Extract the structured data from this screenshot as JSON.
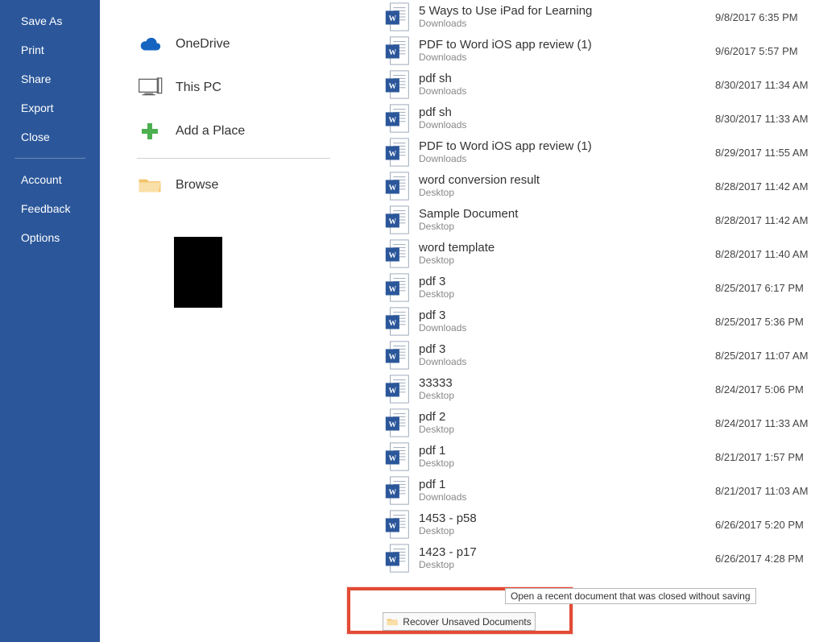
{
  "sidebar": {
    "items": [
      {
        "label": "Save As"
      },
      {
        "label": "Print"
      },
      {
        "label": "Share"
      },
      {
        "label": "Export"
      },
      {
        "label": "Close"
      }
    ],
    "items2": [
      {
        "label": "Account"
      },
      {
        "label": "Feedback"
      },
      {
        "label": "Options"
      }
    ]
  },
  "locations": [
    {
      "icon": "onedrive",
      "label": "OneDrive"
    },
    {
      "icon": "thispc",
      "label": "This PC"
    },
    {
      "icon": "plus",
      "label": "Add a Place"
    },
    {
      "icon": "folder",
      "label": "Browse"
    }
  ],
  "files": [
    {
      "name": "5 Ways to Use iPad for Learning",
      "loc": "Downloads",
      "date": "9/8/2017 6:35 PM"
    },
    {
      "name": "PDF to Word iOS app review (1)",
      "loc": "Downloads",
      "date": "9/6/2017 5:57 PM"
    },
    {
      "name": "pdf sh",
      "loc": "Downloads",
      "date": "8/30/2017 11:34 AM"
    },
    {
      "name": "pdf sh",
      "loc": "Downloads",
      "date": "8/30/2017 11:33 AM"
    },
    {
      "name": "PDF to Word iOS app review (1)",
      "loc": "Downloads",
      "date": "8/29/2017 11:55 AM"
    },
    {
      "name": "word conversion result",
      "loc": "Desktop",
      "date": "8/28/2017 11:42 AM"
    },
    {
      "name": "Sample Document",
      "loc": "Desktop",
      "date": "8/28/2017 11:42 AM"
    },
    {
      "name": "word template",
      "loc": "Desktop",
      "date": "8/28/2017 11:40 AM"
    },
    {
      "name": "pdf 3",
      "loc": "Desktop",
      "date": "8/25/2017 6:17 PM"
    },
    {
      "name": "pdf 3",
      "loc": "Downloads",
      "date": "8/25/2017 5:36 PM"
    },
    {
      "name": "pdf 3",
      "loc": "Downloads",
      "date": "8/25/2017 11:07 AM"
    },
    {
      "name": "33333",
      "loc": "Desktop",
      "date": "8/24/2017 5:06 PM"
    },
    {
      "name": "pdf 2",
      "loc": "Desktop",
      "date": "8/24/2017 11:33 AM"
    },
    {
      "name": "pdf 1",
      "loc": "Desktop",
      "date": "8/21/2017 1:57 PM"
    },
    {
      "name": "pdf 1",
      "loc": "Downloads",
      "date": "8/21/2017 11:03 AM"
    },
    {
      "name": "1453 - p58",
      "loc": "Desktop",
      "date": "6/26/2017 5:20 PM"
    },
    {
      "name": "1423 - p17",
      "loc": "Desktop",
      "date": "6/26/2017 4:28 PM"
    }
  ],
  "recover": {
    "button_label": "Recover Unsaved Documents",
    "tooltip": "Open a recent document that was closed without saving"
  }
}
